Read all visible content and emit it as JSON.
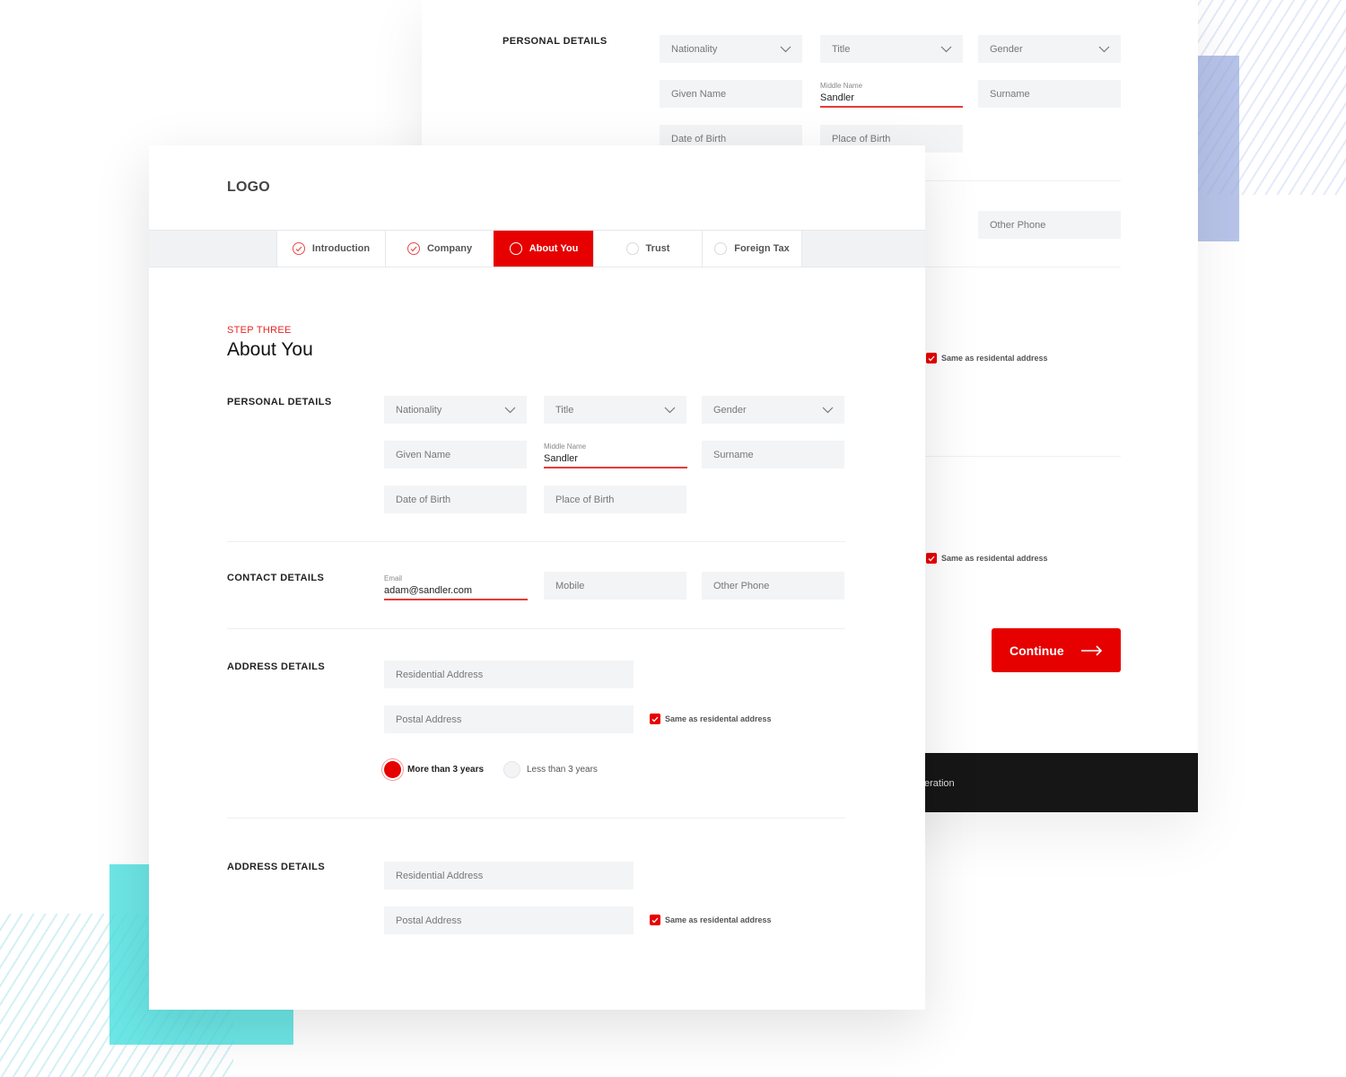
{
  "colors": {
    "accent": "#e60000",
    "field_bg": "#f3f4f6",
    "footer_bg": "#161616"
  },
  "back_card": {
    "personal_details": {
      "label": "PERSONAL DETAILS",
      "nationality": "Nationality",
      "title": "Title",
      "gender": "Gender",
      "given_name": "Given Name",
      "middle_name_label": "Middle Name",
      "middle_name_value": "Sandler",
      "surname": "Surname",
      "date_of_birth": "Date of Birth",
      "place_of_birth": "Place of Birth"
    },
    "contact": {
      "other_phone": "Other Phone"
    },
    "same_address_1": "Same as residental address",
    "same_address_2": "Same as residental address",
    "continue_label": "Continue",
    "footer_text": "eration"
  },
  "front_card": {
    "logo": "LOGO",
    "tabs": [
      {
        "label": "Introduction",
        "state": "done"
      },
      {
        "label": "Company",
        "state": "done"
      },
      {
        "label": "About You",
        "state": "active"
      },
      {
        "label": "Trust",
        "state": "todo"
      },
      {
        "label": "Foreign Tax",
        "state": "todo"
      }
    ],
    "step_label": "STEP THREE",
    "page_title": "About You",
    "personal_details": {
      "label": "PERSONAL DETAILS",
      "nationality": "Nationality",
      "title": "Title",
      "gender": "Gender",
      "given_name": "Given Name",
      "middle_name_label": "Middle Name",
      "middle_name_value": "Sandler",
      "surname": "Surname",
      "date_of_birth": "Date of Birth",
      "place_of_birth": "Place of Birth"
    },
    "contact_details": {
      "label": "CONTACT DETAILS",
      "email_label": "Email",
      "email_value": "adam@sandler.com",
      "mobile": "Mobile",
      "other_phone": "Other Phone"
    },
    "address_details_1": {
      "label": "ADDRESS DETAILS",
      "residential": "Residential Address",
      "postal": "Postal Address",
      "same_as": "Same as residental address",
      "same_as_checked": true,
      "duration_options": [
        "More than 3 years",
        "Less than 3 years"
      ],
      "duration_selected": "More than 3 years"
    },
    "address_details_2": {
      "label": "ADDRESS DETAILS",
      "residential": "Residential Address",
      "postal": "Postal Address",
      "same_as": "Same as residental address",
      "same_as_checked": true
    }
  }
}
